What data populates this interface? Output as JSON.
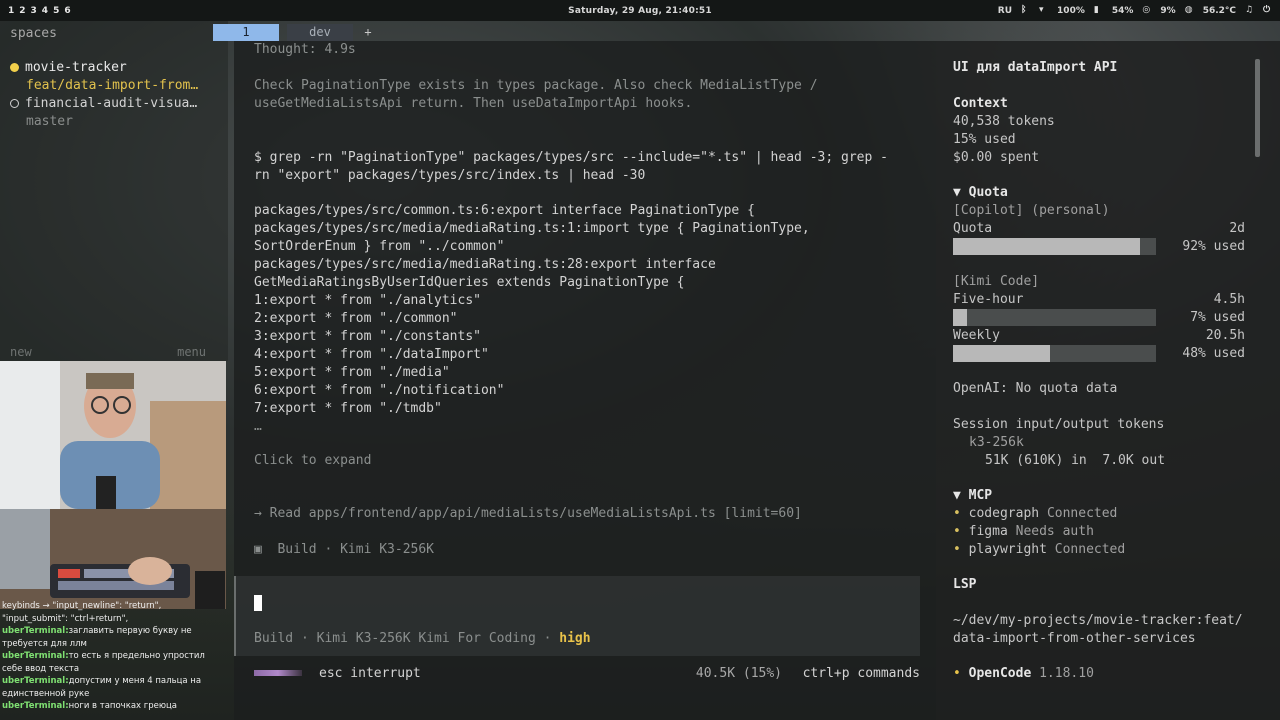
{
  "topbar": {
    "workspaces": [
      "1",
      "2",
      "3",
      "4",
      "5",
      "6"
    ],
    "clock": "Saturday, 29 Aug, 21:40:51",
    "lang": "RU",
    "wifi_pct": "100%",
    "cpu_pct": "54%",
    "mem_pct": "9%",
    "temp": "56.2°C"
  },
  "left": {
    "title": "spaces",
    "items": [
      {
        "label": "movie-tracker",
        "state": "active"
      },
      {
        "label": "feat/data-import-from…",
        "state": "branch"
      },
      {
        "label": "financial-audit-visua…",
        "state": "inactive"
      },
      {
        "label": "master",
        "state": "branch"
      }
    ],
    "new_label": "new",
    "menu_label": "menu"
  },
  "chat": {
    "lines": [
      {
        "user": "",
        "text": "keybinds → \"input_newline\": \"return\","
      },
      {
        "user": "",
        "text": "\"input_submit\": \"ctrl+return\","
      },
      {
        "user": "uberTerminal:",
        "text": "заглавить первую букву не требуется для ллм"
      },
      {
        "user": "uberTerminal:",
        "text": "то есть я предельно упростил себе ввод текста"
      },
      {
        "user": "uberTerminal:",
        "text": "допустим у меня 4 пальца на единственной руке"
      },
      {
        "user": "uberTerminal:",
        "text": "ноги в тапочках греюца"
      }
    ]
  },
  "tabs": [
    {
      "label": "1",
      "state": "active"
    },
    {
      "label": "dev",
      "state": "inactive"
    },
    {
      "label": "+",
      "state": "new"
    }
  ],
  "terminal": {
    "thought": "Thought: 4.9s",
    "reason_1": "Check PaginationType exists in types package. Also check MediaListType /",
    "reason_2": "useGetMediaListsApi return. Then useDataImportApi hooks.",
    "cmd_1": "$ grep -rn \"PaginationType\" packages/types/src --include=\"*.ts\" | head -3; grep -",
    "cmd_2": "rn \"export\" packages/types/src/index.ts | head -30",
    "out": [
      "packages/types/src/common.ts:6:export interface PaginationType {",
      "packages/types/src/media/mediaRating.ts:1:import type { PaginationType,",
      "SortOrderEnum } from \"../common\"",
      "packages/types/src/media/mediaRating.ts:28:export interface",
      "GetMediaRatingsByUserIdQueries extends PaginationType {",
      "1:export * from \"./analytics\"",
      "2:export * from \"./common\"",
      "3:export * from \"./constants\"",
      "4:export * from \"./dataImport\"",
      "5:export * from \"./media\"",
      "6:export * from \"./notification\"",
      "7:export * from \"./tmdb\"",
      "…"
    ],
    "expand": "Click to expand",
    "read": "→ Read apps/frontend/app/api/mediaLists/useMediaListsApi.ts [limit=60]",
    "build_status": "▣  Build · Kimi K3-256K",
    "mode_build": "Build",
    "mode_model": "Kimi K3-256K",
    "mode_provider": "Kimi For Coding",
    "mode_sep": "·",
    "mode_effort": "high",
    "footer_esc": "esc interrupt",
    "footer_tokens": "40.5K (15%)",
    "footer_cmds": "ctrl+p commands"
  },
  "sidebar": {
    "title": "UI для dataImport API",
    "context_h": "Context",
    "context_tokens": "40,538 tokens",
    "context_used": "15% used",
    "context_spent": "$0.00 spent",
    "quota_h": "▼ Quota",
    "copilot": "[Copilot] (personal)",
    "quota_label": "Quota",
    "quota_time": "2d",
    "quota_pct_label": "92% used",
    "quota_fill": 0.92,
    "kimi": "[Kimi Code]",
    "fivehour_label": "Five-hour",
    "fivehour_time": "4.5h",
    "fivehour_pct_label": "7% used",
    "fivehour_fill": 0.07,
    "weekly_label": "Weekly",
    "weekly_time": "20.5h",
    "weekly_pct_label": "48% used",
    "weekly_fill": 0.48,
    "openai": "OpenAI: No quota data",
    "session_h": "Session input/output tokens",
    "session_model": "k3-256k",
    "session_in": "51K (610K) in",
    "session_out": "7.0K out",
    "mcp_h": "▼ MCP",
    "mcp": [
      {
        "name": "codegraph",
        "status": "Connected"
      },
      {
        "name": "figma",
        "status": "Needs auth"
      },
      {
        "name": "playwright",
        "status": "Connected"
      }
    ],
    "lsp_h": "LSP",
    "path_1": "~/dev/my-projects/movie-tracker:feat/",
    "path_2": "data-import-from-other-services",
    "opencode_name": "OpenCode",
    "opencode_ver": "1.18.10"
  }
}
